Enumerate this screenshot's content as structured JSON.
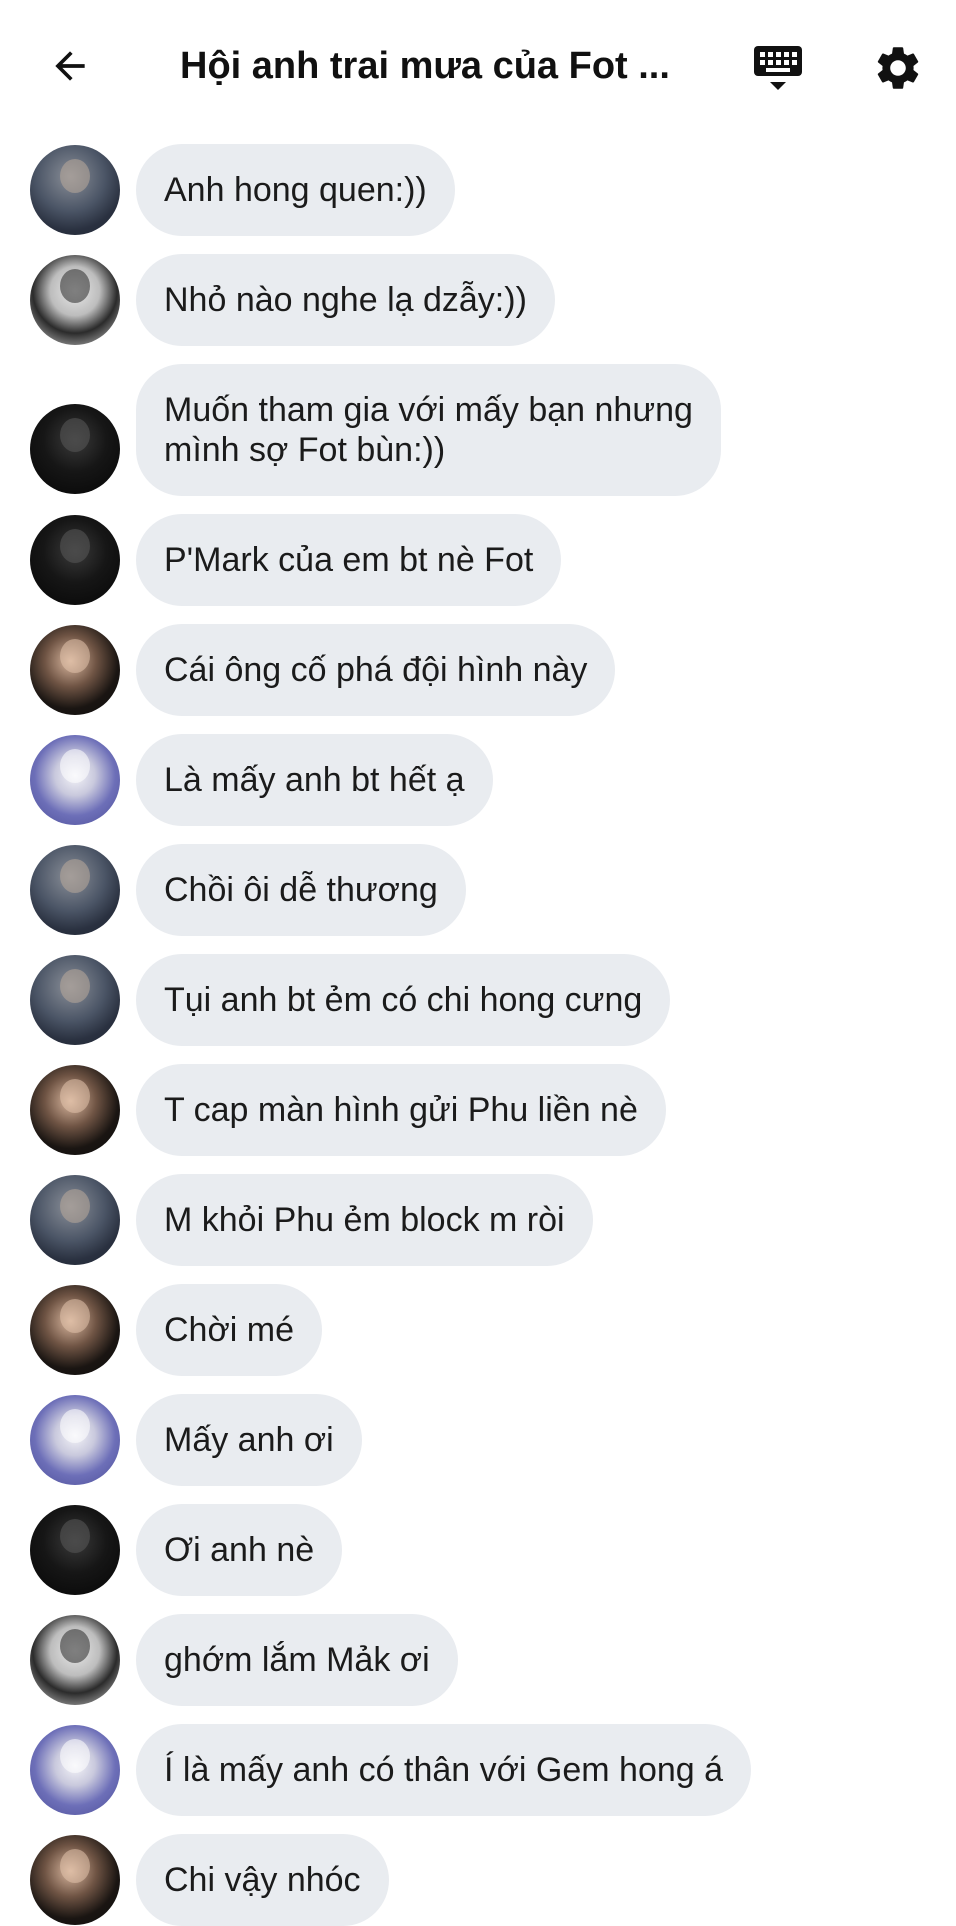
{
  "header": {
    "title": "Hội anh trai mưa của Fot ...",
    "back_icon": "arrow-left-icon",
    "keyboard_icon": "keyboard-icon",
    "settings_icon": "gear-icon"
  },
  "messages": [
    {
      "avatar": "av1",
      "text": "Anh hong quen:))"
    },
    {
      "avatar": "av2",
      "text": "Nhỏ nào nghe lạ dzẫy:))"
    },
    {
      "avatar": "av3",
      "text": "Muốn tham gia với mấy bạn nhưng\nmình sợ Fot bùn:))"
    },
    {
      "avatar": "av3",
      "text": "P'Mark của em bt nè Fot"
    },
    {
      "avatar": "av4",
      "text": "Cái ông cố phá đội hình này"
    },
    {
      "avatar": "av5",
      "text": "Là mấy anh bt hết ạ"
    },
    {
      "avatar": "av1",
      "text": "Chồi ôi dễ thương"
    },
    {
      "avatar": "av1",
      "text": "Tụi anh bt ẻm có chi hong cưng"
    },
    {
      "avatar": "av4",
      "text": "T cap màn hình gửi Phu liền nè"
    },
    {
      "avatar": "av1",
      "text": "M khỏi Phu ẻm block m ròi"
    },
    {
      "avatar": "av4",
      "text": "Chời mé"
    },
    {
      "avatar": "av5",
      "text": "Mấy anh ơi"
    },
    {
      "avatar": "av3",
      "text": "Ơi anh nè"
    },
    {
      "avatar": "av2",
      "text": "ghớm lắm Mảk ơi"
    },
    {
      "avatar": "av5",
      "text": "Í là mấy anh có thân với Gem hong á"
    },
    {
      "avatar": "av4",
      "text": "Chi vậy nhóc"
    }
  ]
}
